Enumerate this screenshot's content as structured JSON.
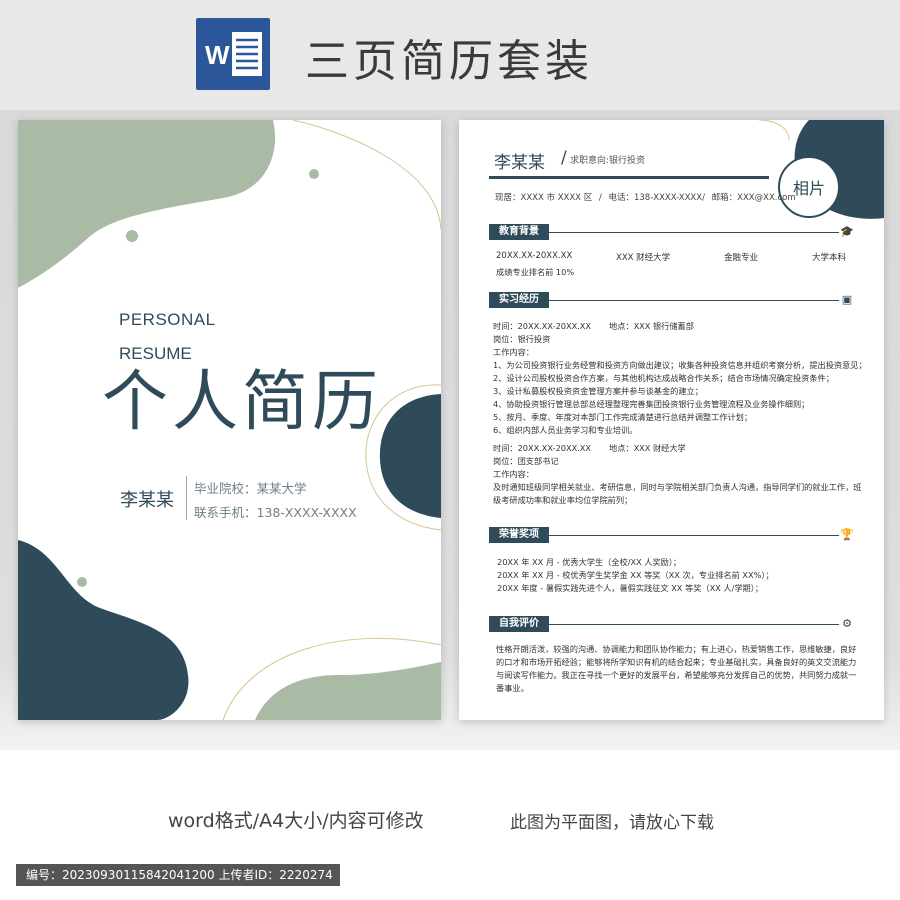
{
  "banner": {
    "title": "三页简历套装",
    "icon": "word-icon",
    "icon_letter": "W"
  },
  "colors": {
    "navy": "#2f4b5a",
    "sage": "#a9bba4",
    "gold": "#d9c38f",
    "banner_bg": "#e8e8e8"
  },
  "cover": {
    "personal": "PERSONAL",
    "resume": "RESUME",
    "title": "个人简历",
    "name": "李某某",
    "school": "毕业院校：某某大学",
    "phone": "联系手机：138-XXXX-XXXX"
  },
  "resume": {
    "name": "李某某",
    "slash": "/",
    "intent": "求职意向:银行投资",
    "photo": "相片",
    "contact": {
      "address": "现居：XXXX 市 XXXX 区",
      "sep1": "/",
      "phone": "电话：138-XXXX-XXXX/",
      "email": "邮箱：XXX@XX.com"
    },
    "sections": {
      "education": "教育背景",
      "internship": "实习经历",
      "honors": "荣誉奖项",
      "self": "自我评价"
    },
    "education": {
      "date": "20XX.XX-20XX.XX",
      "school": "XXX 财经大学",
      "major": "金融专业",
      "degree": "大学本科",
      "rank": "成绩专业排名前 10%"
    },
    "internship1": {
      "time": "时间：20XX.XX-20XX.XX",
      "place": "地点：XXX 银行储蓄部",
      "post": "岗位：银行投资",
      "content": "工作内容：",
      "lines": [
        "1、为公司投资银行业务经营和投资方向做出建议；收集各种投资信息并组织考察分析，提出投资意见；",
        "2、设计公司股权投资合作方案，与其他机构达成战略合作关系；结合市场情况确定投资条件；",
        "3、设计私募股权投资资金管理方案并参与谈基金的建立；",
        "4、协助投资银行管理总部总经理整理完善集团投资银行业务管理流程及业务操作细则；",
        "5、按月、季度、年度对本部门工作完成清楚进行总结并调整工作计划；",
        "6、组织内部人员业务学习和专业培训。"
      ]
    },
    "internship2": {
      "time": "时间：20XX.XX-20XX.XX",
      "place": "地点：XXX 财经大学",
      "post": "岗位：团支部书记",
      "content": "工作内容：",
      "lines": [
        "及时通知班级同学相关就业、考研信息，同时与学院相关部门负责人沟通，指导同学们的就业工作，班",
        "级考研成功率和就业率均位学院前列；"
      ]
    },
    "honors": [
      "20XX 年 XX 月 - 优秀大学生（全校/XX 人奖励）；",
      "20XX 年 XX 月 - 校优秀学生奖学金 XX 等奖（XX 次，专业排名前 XX%）；",
      "20XX 年度 - 暑假实践先进个人，暑假实践征文 XX 等奖（XX 人/学期）；"
    ],
    "self_eval": [
      "性格开朗活泼，较强的沟通、协调能力和团队协作能力；有上进心，热爱销售工作，思维敏捷，良好",
      "的口才和市场开拓经验；能够将所学知识有机的结合起来；专业基础扎实，具备良好的英文交流能力",
      "与阅读写作能力。我正在寻找一个更好的发展平台，希望能够充分发挥自己的优势，共同努力成就一",
      "番事业。"
    ]
  },
  "footer": {
    "format": "word格式/A4大小/内容可修改",
    "note": "此图为平面图，请放心下载",
    "id_text": "编号：20230930115842041200  上传者ID：2220274"
  }
}
